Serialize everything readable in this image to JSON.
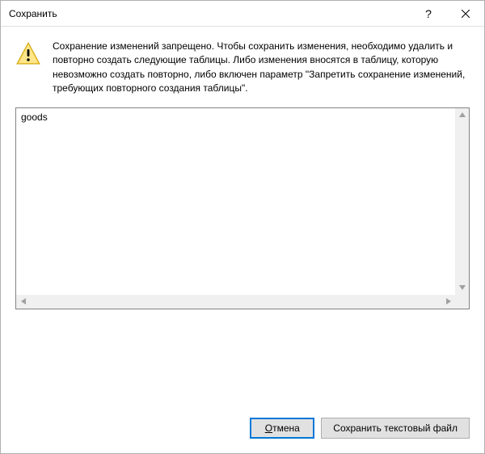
{
  "title": "Сохранить",
  "message": "Сохранение изменений запрещено. Чтобы сохранить изменения, необходимо удалить и повторно создать следующие таблицы. Либо изменения вносятся в таблицу, которую невозможно создать повторно, либо включен параметр \"Запретить сохранение изменений, требующих повторного создания таблицы\".",
  "list": {
    "items": [
      "goods"
    ]
  },
  "buttons": {
    "cancel": "Отмена",
    "cancel_accel_pos": 0,
    "save_text": "Сохранить текстовый файл"
  }
}
